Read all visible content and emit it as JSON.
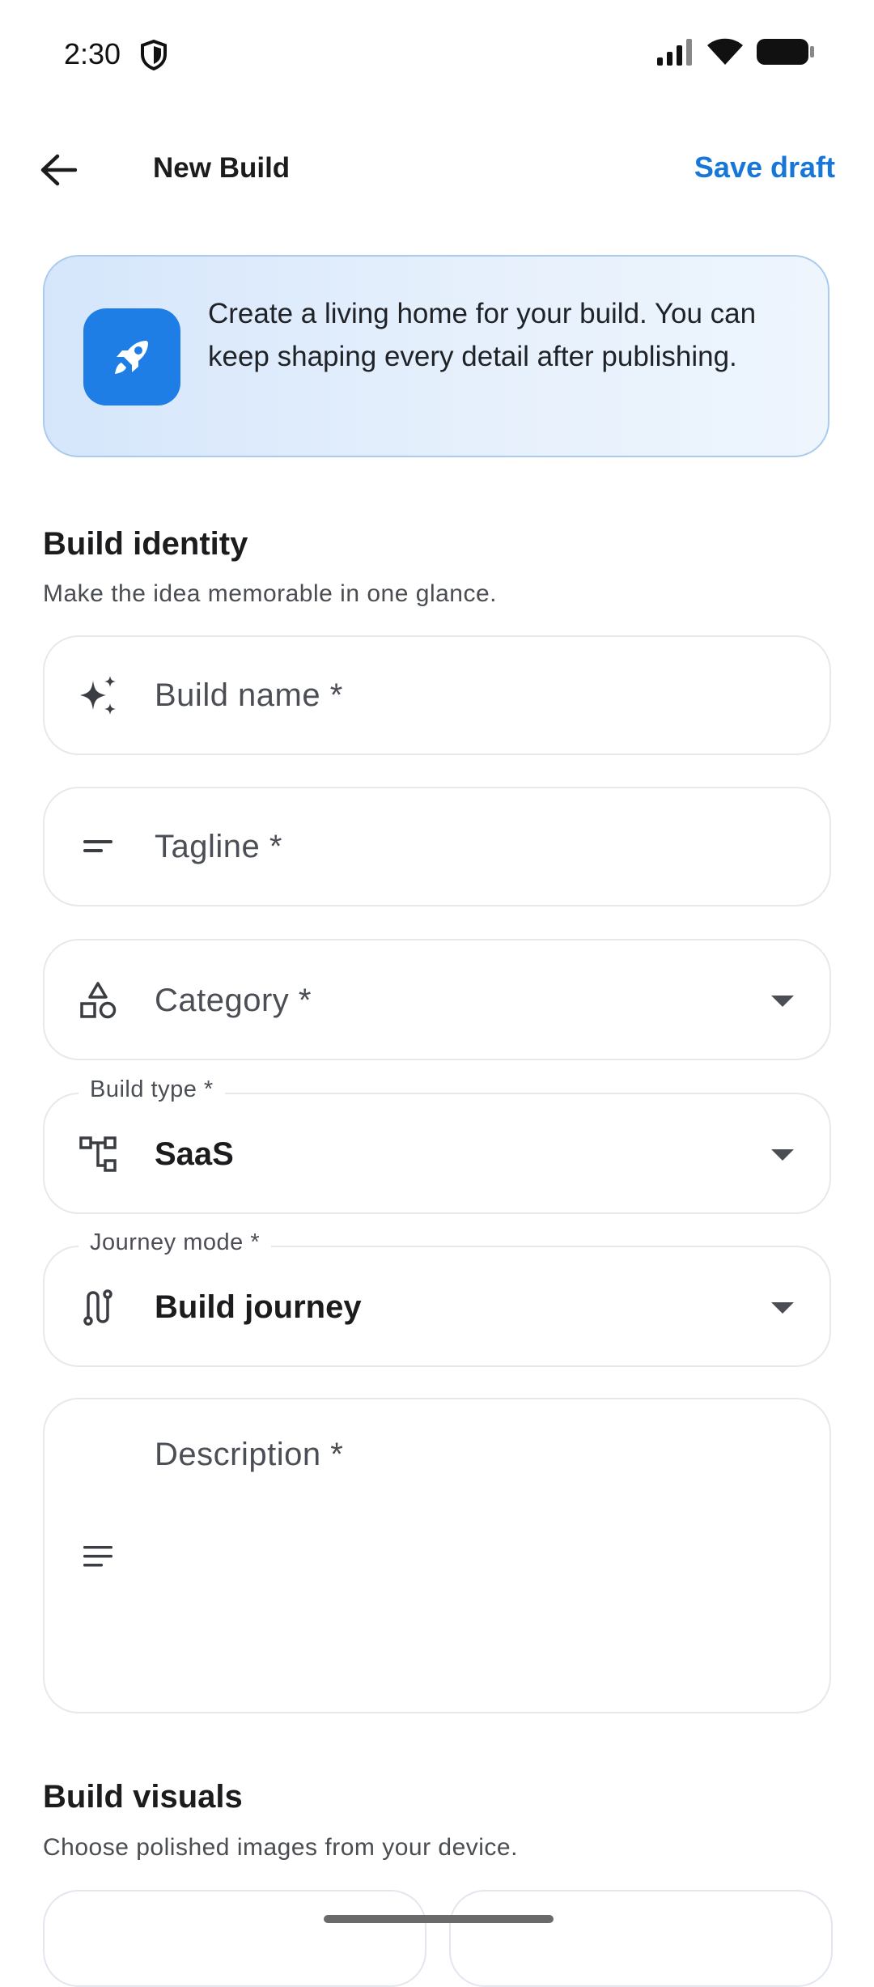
{
  "status_bar": {
    "time": "2:30"
  },
  "app_bar": {
    "title": "New Build",
    "save_label": "Save draft"
  },
  "banner": {
    "text": "Create a living home for your build. You can keep shaping every detail after publishing.",
    "icon": "rocket-icon"
  },
  "identity": {
    "title": "Build identity",
    "subtitle": "Make the idea memorable in one glance.",
    "fields": {
      "name": {
        "placeholder": "Build name *",
        "icon": "sparkle-icon"
      },
      "tagline": {
        "placeholder": "Tagline *",
        "icon": "short-text-icon"
      },
      "category": {
        "placeholder": "Category *",
        "icon": "shapes-icon"
      },
      "build_type": {
        "label": "Build type *",
        "value": "SaaS",
        "icon": "hierarchy-icon"
      },
      "journey_mode": {
        "label": "Journey mode *",
        "value": "Build journey",
        "icon": "route-icon"
      },
      "description": {
        "placeholder": "Description *",
        "icon": "notes-icon"
      }
    }
  },
  "visuals": {
    "title": "Build visuals",
    "subtitle": "Choose polished images from your device."
  },
  "colors": {
    "accent": "#1677d8",
    "banner_icon_bg": "#1e7ee6"
  }
}
